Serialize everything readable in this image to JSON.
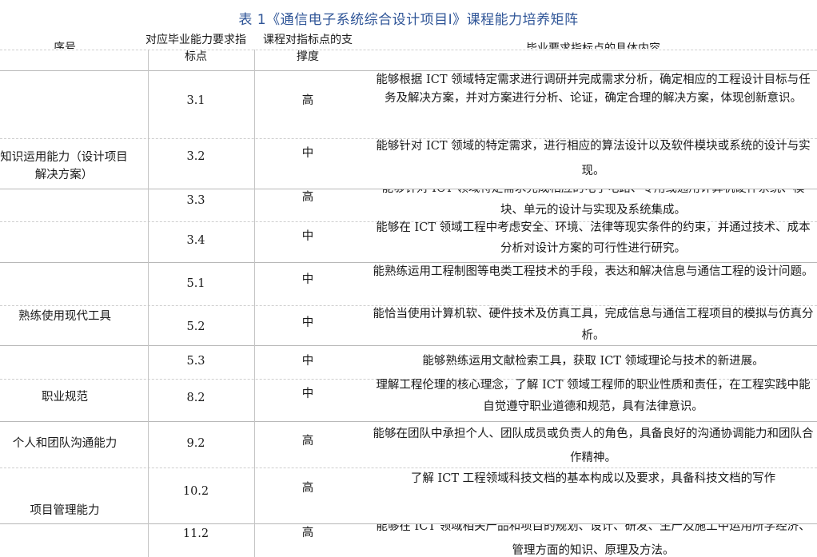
{
  "title": "表 1《通信电子系统综合设计项目Ⅰ》课程能力培养矩阵",
  "headers": {
    "index": "序号",
    "indicator": "对应毕业能力要求指标点",
    "support": "课程对指标点的支撑度",
    "content": "毕业要求指标点的具体内容"
  },
  "categories": [
    "知识运用能力（设计项目解决方案）",
    "熟练使用现代工具",
    "职业规范",
    "个人和团队沟通能力",
    "项目管理能力"
  ],
  "rows": [
    {
      "code": "3.1",
      "level": "高",
      "content": "能够根据 ICT 领域特定需求进行调研并完成需求分析，确定相应的工程设计目标与任务及解决方案，并对方案进行分析、论证，确定合理的解决方案，体现创新意识。"
    },
    {
      "code": "3.2",
      "level": "中",
      "content": "能够针对 ICT 领域的特定需求，进行相应的算法设计以及软件模块或系统的设计与实现。"
    },
    {
      "code": "3.3",
      "level": "高",
      "content": "能够针对 ICT 领域特定需求完成相应的电子电路、专用或通用计算机硬件系统、模块、单元的设计与实现及系统集成。"
    },
    {
      "code": "3.4",
      "level": "中",
      "content": "能够在 ICT 领域工程中考虑安全、环境、法律等现实条件的约束，并通过技术、成本分析对设计方案的可行性进行研究。"
    },
    {
      "code": "5.1",
      "level": "中",
      "content": "能熟练运用工程制图等电类工程技术的手段，表达和解决信息与通信工程的设计问题。"
    },
    {
      "code": "5.2",
      "level": "中",
      "content": "能恰当使用计算机软、硬件技术及仿真工具，完成信息与通信工程项目的模拟与仿真分析。"
    },
    {
      "code": "5.3",
      "level": "中",
      "content": "能够熟练运用文献检索工具，获取 ICT 领域理论与技术的新进展。"
    },
    {
      "code": "8.2",
      "level": "中",
      "content": "理解工程伦理的核心理念，了解 ICT 领域工程师的职业性质和责任，在工程实践中能自觉遵守职业道德和规范，具有法律意识。"
    },
    {
      "code": "9.2",
      "level": "高",
      "content": "能够在团队中承担个人、团队成员或负责人的角色，具备良好的沟通协调能力和团队合作精神。"
    },
    {
      "code": "10.2",
      "level": "高",
      "content": "了解 ICT 工程领域科技文档的基本构成以及要求，具备科技文档的写作"
    },
    {
      "code": "11.2",
      "level": "高",
      "content": "能够在 ICT 领域相关产品和项目的规划、设计、研发、生产及施工中运用所学经济、管理方面的知识、原理及方法。"
    }
  ]
}
